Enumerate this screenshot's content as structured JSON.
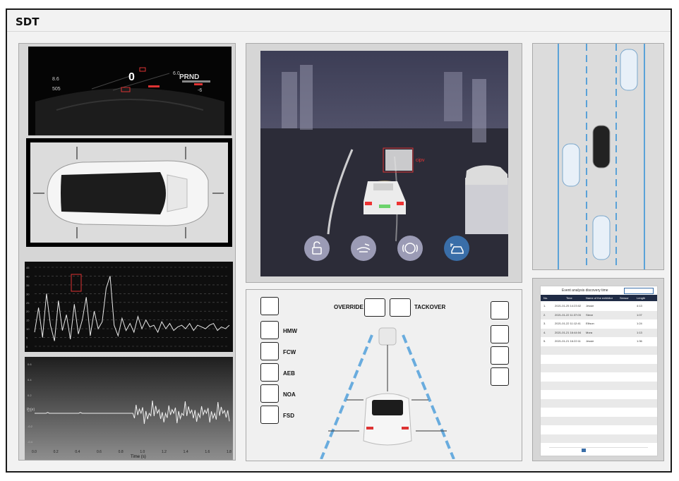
{
  "app": {
    "title": "SDT"
  },
  "dashboard": {
    "gear": "PRND",
    "speed": "0",
    "left_val1": "8.6",
    "left_val2": "505",
    "right_val": "6.0",
    "right_val2": "-6"
  },
  "camera": {
    "label": "cipv"
  },
  "hud": {
    "override_label": "OVERRIDE",
    "takeover_label": "TACKOVER",
    "features": [
      "HMW",
      "FCW",
      "AEB",
      "NOA",
      "FSD"
    ]
  },
  "charts": {
    "top": {
      "type": "line",
      "y_ticks": [
        "45",
        "40",
        "35",
        "30",
        "25",
        "20",
        "15",
        "10",
        "5",
        "0"
      ],
      "values": [
        8,
        22,
        5,
        30,
        12,
        3,
        26,
        9,
        18,
        4,
        24,
        7,
        15,
        28,
        6,
        20,
        10,
        14,
        33,
        40,
        12,
        6,
        16,
        9,
        13,
        8,
        17,
        10,
        15,
        11,
        12,
        8,
        14,
        10,
        13,
        9,
        11,
        12,
        10,
        13,
        9,
        12,
        11,
        10,
        12,
        13,
        9,
        11,
        10,
        12
      ]
    },
    "bottom": {
      "type": "line",
      "xlabel": "Time (s)",
      "ylabel": "Pr(e)",
      "x_ticks": [
        "0.0",
        "0.2",
        "0.4",
        "0.6",
        "0.8",
        "1.0",
        "1.2",
        "1.4",
        "1.6",
        "1.8"
      ],
      "y_ticks": [
        "0.6",
        "0.4",
        "0.2",
        "0.0",
        "-0.2",
        "-0.4"
      ]
    }
  },
  "table": {
    "title": "Event analysis discovery time",
    "headers": [
      "No.",
      "Time",
      "Name of the exhibitor",
      "Sensor",
      "Length"
    ],
    "rows": [
      [
        "1.",
        "2021-01-25 14:23:02",
        "Jessie",
        "",
        "4:13"
      ],
      [
        "2.",
        "2021-01-22 11:37:03",
        "Steve",
        "",
        "1:07"
      ],
      [
        "3.",
        "2021-01-22 11:12:41",
        "Ellison",
        "",
        "1:24"
      ],
      [
        "4.",
        "2021-01-21 16:44:04",
        "Mora",
        "",
        "1:13"
      ],
      [
        "5.",
        "2021-01-21 16:22:11",
        "Jessie",
        "",
        "1:36"
      ]
    ]
  },
  "colors": {
    "accent": "#3a6ea8",
    "lane": "#2f8fd6",
    "frame": "#1a1a1a"
  }
}
